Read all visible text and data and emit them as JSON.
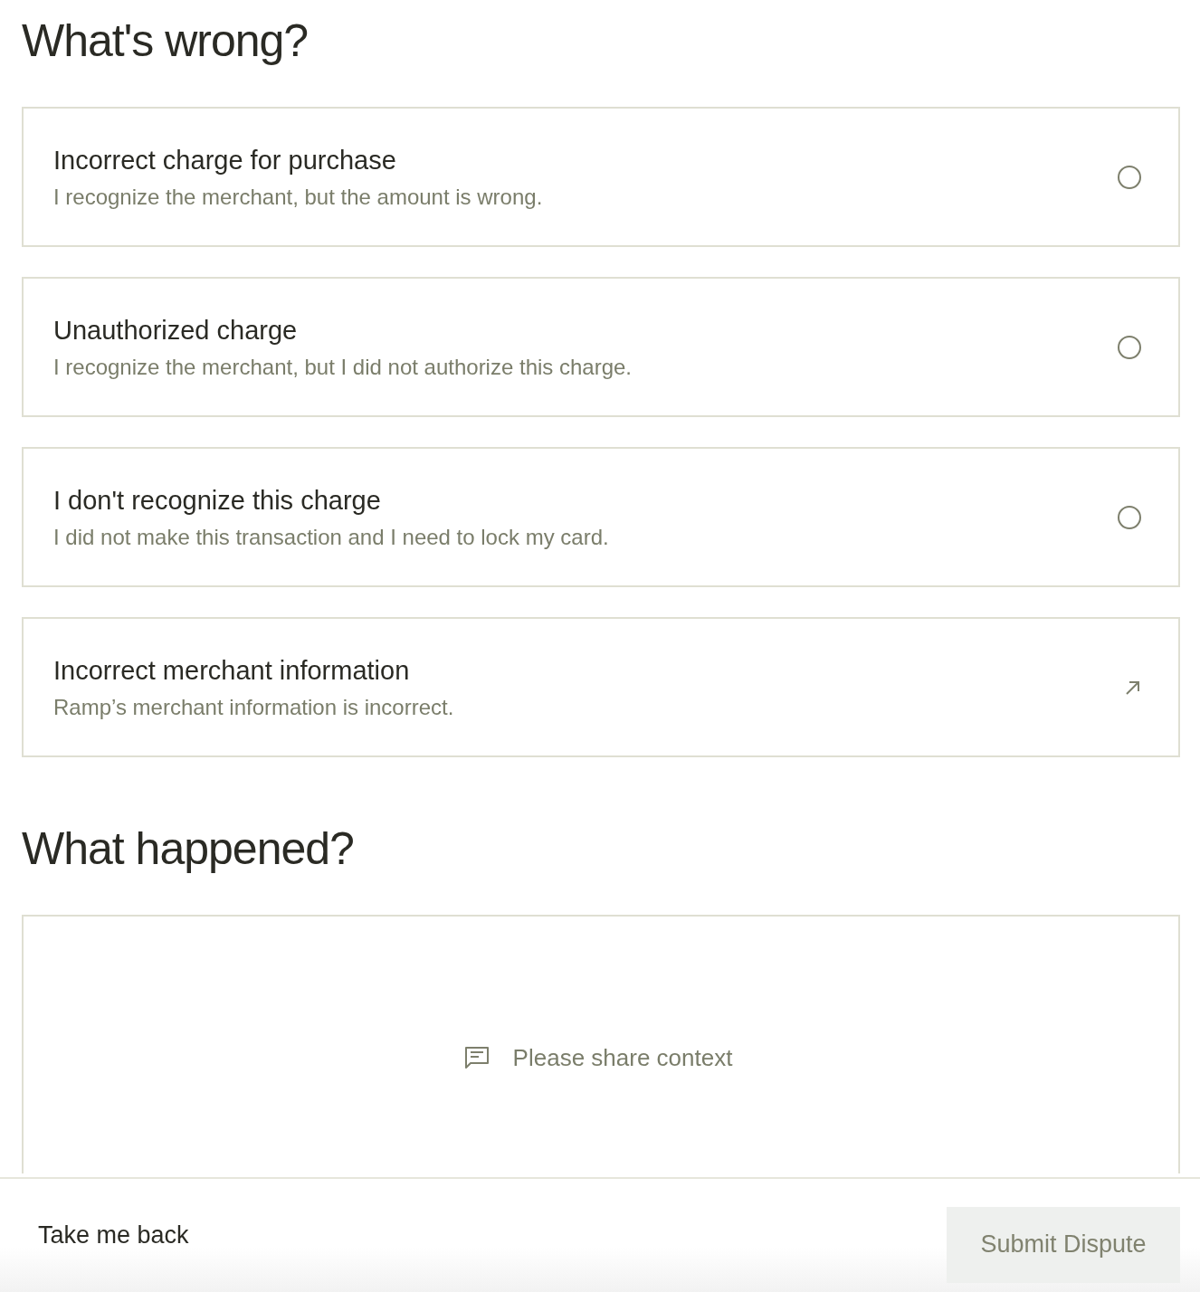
{
  "sections": [
    {
      "heading": "What's wrong?"
    },
    {
      "heading": "What happened?"
    }
  ],
  "options": [
    {
      "kind": "radio",
      "title": "Incorrect charge for purchase",
      "description": "I recognize the merchant, but the amount is wrong.",
      "selected": false
    },
    {
      "kind": "radio",
      "title": "Unauthorized charge",
      "description": "I recognize the merchant, but I did not authorize this charge.",
      "selected": false
    },
    {
      "kind": "radio",
      "title": "I don't recognize this charge",
      "description": "I did not make this transaction and I need to lock my card.",
      "selected": false
    },
    {
      "kind": "link",
      "title": "Incorrect merchant information",
      "description": "Ramp’s merchant information is incorrect."
    }
  ],
  "context_field": {
    "placeholder": "Please share context"
  },
  "footer": {
    "back_label": "Take me back",
    "submit": {
      "label": "Submit Dispute",
      "disabled": true
    }
  }
}
